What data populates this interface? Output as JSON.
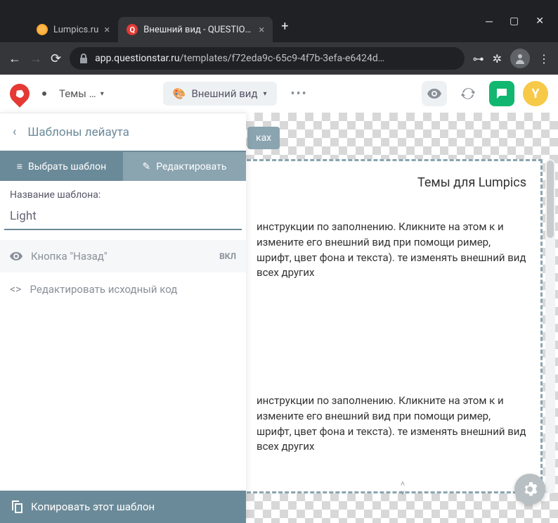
{
  "browser": {
    "tabs": [
      {
        "title": "Lumpics.ru"
      },
      {
        "title": "Внешний вид - QUESTIONSTAR"
      }
    ],
    "url_domain": "app.questionstar.ru",
    "url_path": "/templates/f72eda9c-65c9-4f7b-3efa-e6424d…"
  },
  "appbar": {
    "breadcrumb": "Темы …",
    "view_label": "Внешний вид",
    "user_initial": "Y"
  },
  "sidebar": {
    "title": "Шаблоны лейаута",
    "tab_select": "Выбрать шаблон",
    "tab_edit": "Редактировать",
    "name_label": "Название шаблона:",
    "name_value": "Light",
    "row_back": "Кнопка \"Назад\"",
    "row_back_badge": "ВКЛ",
    "row_code": "Редактировать исходный код",
    "footer": "Копировать этот шаблон"
  },
  "canvas": {
    "lang_chip": "ках",
    "survey_title": "Темы для Lumpics",
    "paragraph1": " инструкции по заполнению. Кликните на этом к и измените его внешний вид при помощи ример, шрифт, цвет фона и текста). те изменять внешний вид всех других",
    "paragraph2": " инструкции по заполнению. Кликните на этом к и измените его внешний вид при помощи ример, шрифт, цвет фона и текста). те изменять внешний вид всех других"
  }
}
